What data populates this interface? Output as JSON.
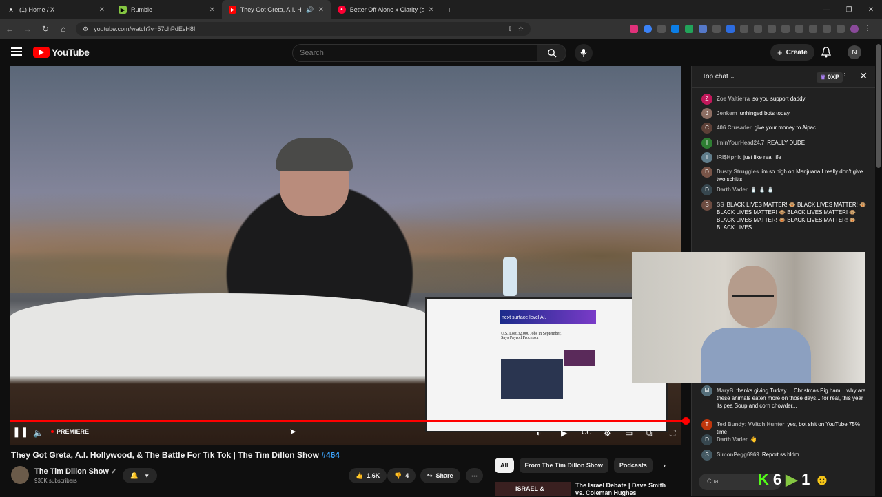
{
  "browser": {
    "tabs": [
      {
        "title": "(1) Home / X",
        "icon": "x-logo-icon"
      },
      {
        "title": "Rumble",
        "icon": "rumble-icon"
      },
      {
        "title": "They Got Greta, A.I. Hollyw",
        "icon": "youtube-icon",
        "active": true
      },
      {
        "title": "Better Off Alone x Clarity (agai",
        "icon": "youtube-music-icon"
      }
    ],
    "url": "youtube.com/watch?v=57chPdEsH8I"
  },
  "youtube": {
    "logo_text": "YouTube",
    "search_placeholder": "Search",
    "create_label": "Create",
    "account_initial": "N"
  },
  "player": {
    "status_label": "PREMIERE",
    "screen_ad": "next surface level AI.",
    "screen_headline": "U.S. Lost 32,000 Jobs in September, Says Payroll Processor",
    "progress": 1.0
  },
  "video": {
    "title": "They Got Greta, A.I. Hollywood, & The Battle For Tik Tok | The Tim Dillon Show ",
    "hashtag": "#464",
    "channel": "The Tim Dillon Show",
    "subscribers": "936K subscribers",
    "likes": "1.6K",
    "dislikes": "4",
    "share_label": "Share"
  },
  "chips": [
    "All",
    "From The Tim Dillon Show",
    "Podcasts"
  ],
  "recommended": {
    "title": "The Israel Debate | Dave Smith vs. Coleman Hughes",
    "thumb_text": "ISRAEL &"
  },
  "chat": {
    "header": "Top chat",
    "xp": "0XP",
    "input_placeholder": "Chat...",
    "messages": [
      {
        "initial": "Z",
        "color": "#c2185b",
        "author": "Zoe Valtierra",
        "text": "so you support daddy"
      },
      {
        "initial": "J",
        "color": "#8d6e63",
        "author": "Jenkem",
        "text": "unhinged bots today"
      },
      {
        "initial": "C",
        "color": "#5d4037",
        "author": "406 Crusader",
        "text": "give your money to Aipac"
      },
      {
        "initial": "I",
        "color": "#2e7d32",
        "author": "ImInYourHead24.7",
        "text": "REALLY DUDE"
      },
      {
        "initial": "I",
        "color": "#607d8b",
        "author": "IRI$Hprik",
        "text": "just like real life"
      },
      {
        "initial": "D",
        "color": "#795548",
        "author": "Dusty Struggles",
        "text": "im so high on Marijuana I really don't give two schitts"
      },
      {
        "initial": "D",
        "color": "#37474f",
        "author": "Darth Vader",
        "text": "🧂 🧂 🧂"
      },
      {
        "initial": "S",
        "color": "#6d4c41",
        "author": "SS",
        "text": "BLACK LIVES MATTER! 🐵 BLACK LIVES MATTER! 🐵 BLACK LIVES MATTER! 🐵 BLACK LIVES MATTER! 🐵 BLACK LIVES MATTER! 🐵 BLACK LIVES MATTER! 🐵 BLACK LIVES"
      },
      {
        "initial": "M",
        "color": "#546e7a",
        "author": "MaryB",
        "text": "thanks giving Turkey.... Christmas Pig ham... why are these animals eaten more on those days... for real, this year its pea Soup and corn chowder..."
      },
      {
        "initial": "T",
        "color": "#bf360c",
        "author": "Ted Bundy: VVitch Hunter",
        "text": "yes, bot shit on YouTube 75% time"
      },
      {
        "initial": "D",
        "color": "#37474f",
        "author": "Darth Vader",
        "text": "👋"
      },
      {
        "initial": "S",
        "color": "#455a64",
        "author": "SimonPegg6969",
        "text": "Report ss bldm"
      }
    ]
  },
  "overlay": {
    "numbers": [
      "6",
      "1"
    ]
  }
}
